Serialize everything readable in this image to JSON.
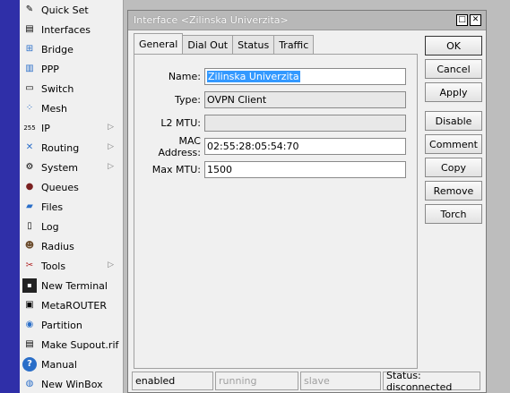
{
  "menu": [
    {
      "label": "Quick Set",
      "icon": "quick-set-icon",
      "arrow": false
    },
    {
      "label": "Interfaces",
      "icon": "interfaces-icon",
      "arrow": false
    },
    {
      "label": "Bridge",
      "icon": "bridge-icon",
      "arrow": false
    },
    {
      "label": "PPP",
      "icon": "ppp-icon",
      "arrow": false
    },
    {
      "label": "Switch",
      "icon": "switch-icon",
      "arrow": false
    },
    {
      "label": "Mesh",
      "icon": "mesh-icon",
      "arrow": false
    },
    {
      "label": "IP",
      "icon": "ip-icon",
      "arrow": true
    },
    {
      "label": "Routing",
      "icon": "routing-icon",
      "arrow": true
    },
    {
      "label": "System",
      "icon": "system-icon",
      "arrow": true
    },
    {
      "label": "Queues",
      "icon": "queues-icon",
      "arrow": false
    },
    {
      "label": "Files",
      "icon": "files-icon",
      "arrow": false
    },
    {
      "label": "Log",
      "icon": "log-icon",
      "arrow": false
    },
    {
      "label": "Radius",
      "icon": "radius-icon",
      "arrow": false
    },
    {
      "label": "Tools",
      "icon": "tools-icon",
      "arrow": true
    },
    {
      "label": "New Terminal",
      "icon": "terminal-icon",
      "arrow": false
    },
    {
      "label": "MetaROUTER",
      "icon": "metarouter-icon",
      "arrow": false
    },
    {
      "label": "Partition",
      "icon": "partition-icon",
      "arrow": false
    },
    {
      "label": "Make Supout.rif",
      "icon": "supout-icon",
      "arrow": false
    },
    {
      "label": "Manual",
      "icon": "manual-icon",
      "arrow": false
    },
    {
      "label": "New WinBox",
      "icon": "winbox-icon",
      "arrow": false
    }
  ],
  "window": {
    "title": "Interface <Zilinska Univerzita>",
    "tabs": [
      "General",
      "Dial Out",
      "Status",
      "Traffic"
    ],
    "active_tab": "General",
    "fields": {
      "name": {
        "label": "Name:",
        "value": "Zilinska Univerzita"
      },
      "type": {
        "label": "Type:",
        "value": "OVPN Client"
      },
      "l2mtu": {
        "label": "L2 MTU:",
        "value": ""
      },
      "mac": {
        "label": "MAC Address:",
        "value": "02:55:28:05:54:70"
      },
      "maxmtu": {
        "label": "Max MTU:",
        "value": "1500"
      }
    },
    "buttons": {
      "ok": "OK",
      "cancel": "Cancel",
      "apply": "Apply",
      "disable": "Disable",
      "comment": "Comment",
      "copy": "Copy",
      "remove": "Remove",
      "torch": "Torch"
    },
    "status": {
      "enabled": "enabled",
      "running": "running",
      "slave": "slave",
      "connection": "Status: disconnected"
    }
  },
  "colors": {
    "left_strip": "#2f2fa8",
    "selection": "#3399ff"
  }
}
